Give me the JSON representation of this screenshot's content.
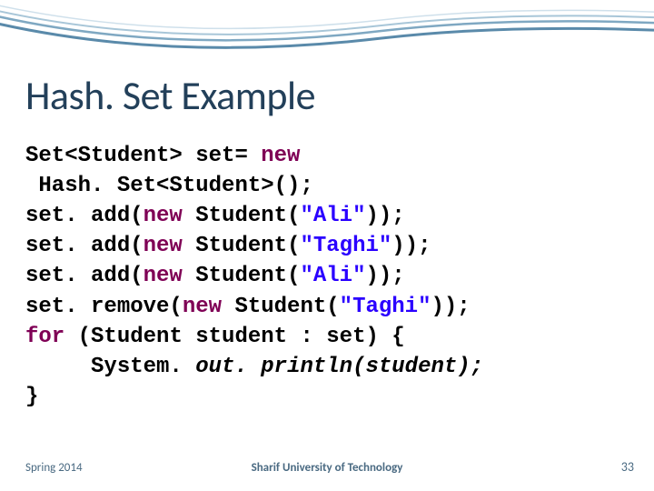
{
  "title": "Hash. Set Example",
  "code": {
    "line1a": "Set<Student> set= ",
    "kw_new": "new",
    "line2": " Hash. Set<Student>();",
    "line3a": "set. add(",
    "line3b": " Student(",
    "str_ali": "\"Ali\"",
    "line3c": "));",
    "line4a": "set. add(",
    "line4b": " Student(",
    "str_taghi": "\"Taghi\"",
    "line4c": "));",
    "line5a": "set. add(",
    "line5b": " Student(",
    "line5c": "));",
    "line6a": "set. remove(",
    "line6b": " Student(",
    "line6c": "));",
    "kw_for": "for",
    "line7a": " (Student student : set) {",
    "line8a": "     System. ",
    "out": "out",
    "println": ". println(student);",
    "line9": "}"
  },
  "footer": {
    "left": "Spring 2014",
    "center": "Sharif University of Technology",
    "right": "33"
  }
}
